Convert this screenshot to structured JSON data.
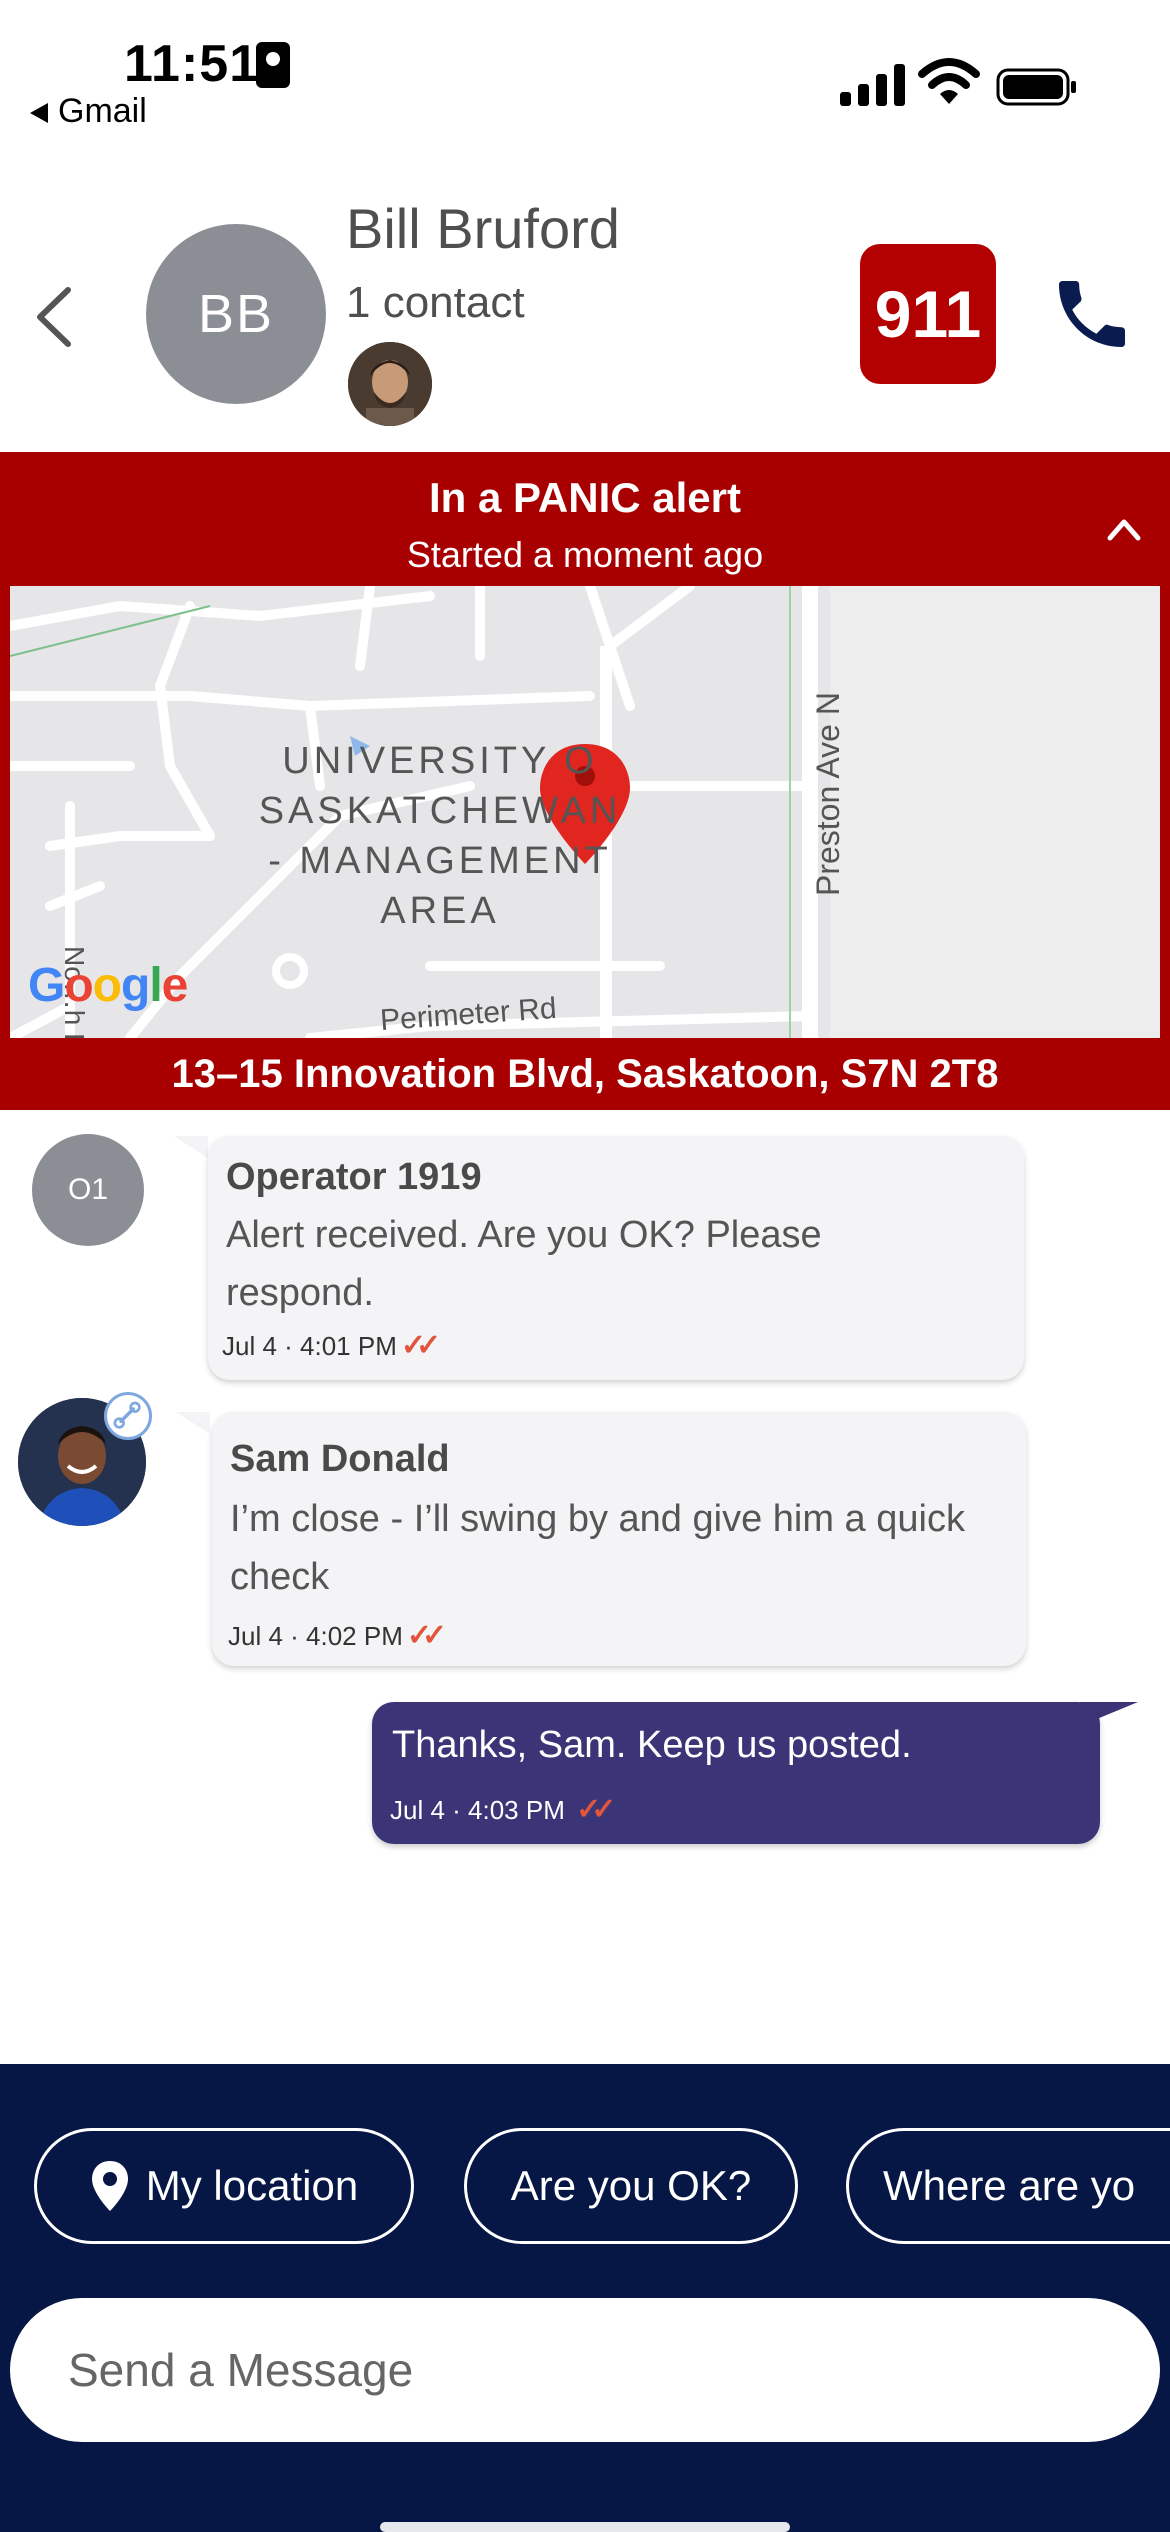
{
  "status_bar": {
    "time": "11:51",
    "back_app": "Gmail"
  },
  "header": {
    "avatar_initials": "BB",
    "contact_name": "Bill Bruford",
    "contact_count": "1 contact",
    "emergency_label": "911",
    "colors": {
      "emergency": "#b30000",
      "phone": "#0a1b4f"
    }
  },
  "alert": {
    "title": "In a PANIC alert",
    "subtitle": "Started a moment ago",
    "address": "13–15 Innovation Blvd, Saskatoon, S7N 2T8",
    "color": "#a80000",
    "map": {
      "area_label_lines": [
        "UNIVERSITY O",
        "SASKATCHEWAN",
        "- MANAGEMENT",
        "AREA"
      ],
      "street_east": "Preston Ave N",
      "street_south": "Perimeter Rd",
      "street_west": "No…h R",
      "logo": "Google"
    }
  },
  "messages": [
    {
      "avatar_initials": "O1",
      "sender": "Operator 1919",
      "body": "Alert received. Are you OK? Please respond.",
      "timestamp": "Jul 4 · 4:01 PM",
      "read_ticks": "✓✓"
    },
    {
      "sender": "Sam Donald",
      "body": "I’m close - I’ll swing by and give him a quick check",
      "timestamp": "Jul 4 · 4:02 PM",
      "read_ticks": "✓✓"
    },
    {
      "body": "Thanks, Sam. Keep us posted.",
      "timestamp": "Jul 4 · 4:03 PM",
      "read_ticks": "✓✓",
      "outgoing": true
    }
  ],
  "quick_replies": [
    {
      "label": "My location",
      "icon": "location-pin-icon"
    },
    {
      "label": "Are you OK?"
    },
    {
      "label": "Where are yo"
    }
  ],
  "composer": {
    "placeholder": "Send a Message",
    "background": "#061645"
  }
}
